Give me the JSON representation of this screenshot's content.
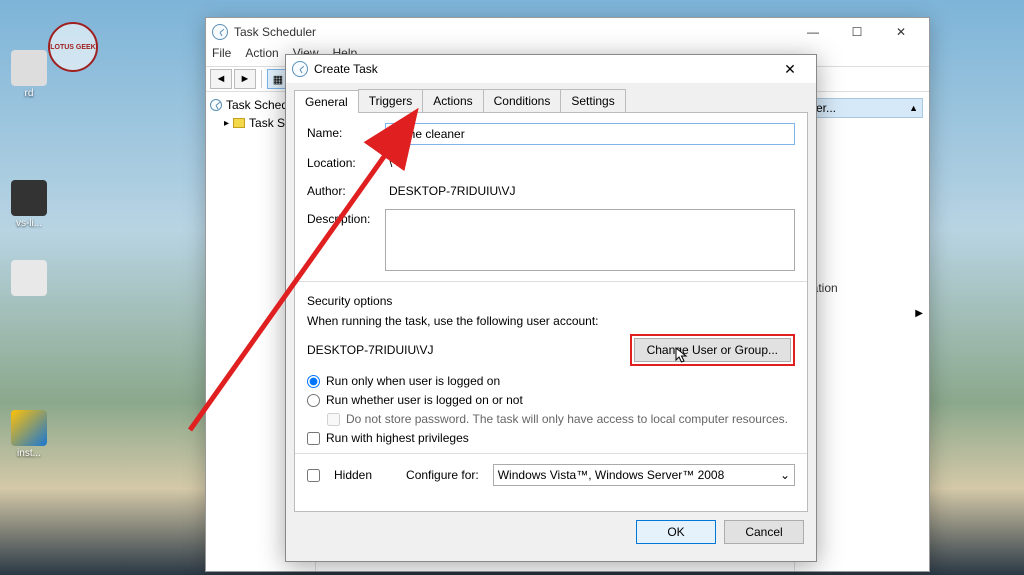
{
  "watermark_text": "LOTUS GEEK",
  "desktop_icons": [
    {
      "label": "rd"
    },
    {
      "label": "vs-li..."
    },
    {
      "label": ""
    },
    {
      "label": "inst..."
    }
  ],
  "task_scheduler": {
    "title": "Task Scheduler",
    "menu": [
      "File",
      "Action",
      "View",
      "Help"
    ],
    "tree": {
      "root": "Task Scheduler",
      "child": "Task S"
    },
    "actions_visible": [
      "uter...",
      "uration"
    ]
  },
  "create_task": {
    "title": "Create Task",
    "tabs": [
      "General",
      "Triggers",
      "Actions",
      "Conditions",
      "Settings"
    ],
    "active_tab": "General",
    "fields": {
      "name_label": "Name:",
      "name_value": "cache cleaner",
      "location_label": "Location:",
      "location_value": "\\",
      "author_label": "Author:",
      "author_value": "DESKTOP-7RIDUIU\\VJ",
      "description_label": "Description:",
      "description_value": ""
    },
    "security": {
      "section_label": "Security options",
      "when_running_label": "When running the task, use the following user account:",
      "user_account": "DESKTOP-7RIDUIU\\VJ",
      "change_user_btn": "Change User or Group...",
      "radio_logged_on": "Run only when user is logged on",
      "radio_logged_off": "Run whether user is logged on or not",
      "no_store_pw": "Do not store password.  The task will only have access to local computer resources.",
      "highest_priv": "Run with highest privileges"
    },
    "hidden_label": "Hidden",
    "configure_for_label": "Configure for:",
    "configure_for_value": "Windows Vista™, Windows Server™ 2008",
    "buttons": {
      "ok": "OK",
      "cancel": "Cancel"
    }
  }
}
